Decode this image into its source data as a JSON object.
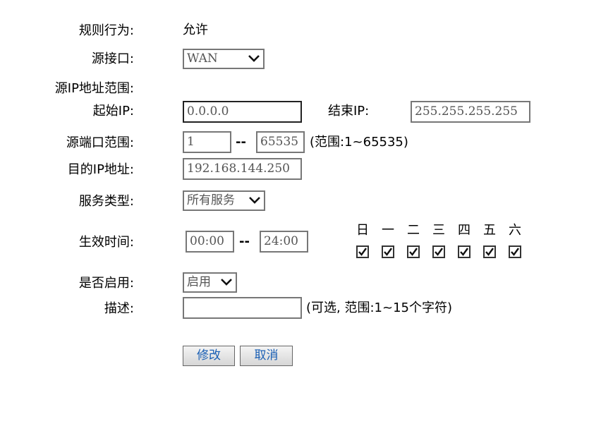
{
  "form": {
    "rule_action": {
      "label": "规则行为:",
      "value": "允许"
    },
    "src_interface": {
      "label": "源接口:",
      "value": "WAN"
    },
    "src_ip_range": {
      "label": "源IP地址范围:"
    },
    "start_ip": {
      "label": "起始IP:",
      "value": "0.0.0.0"
    },
    "end_ip": {
      "label": "结束IP:",
      "value": "255.255.255.255"
    },
    "src_port_range": {
      "label": "源端口范围:",
      "from": "1",
      "to": "65535",
      "separator": "--",
      "hint": "(范围:1~65535)"
    },
    "dest_ip": {
      "label": "目的IP地址:",
      "value": "192.168.144.250"
    },
    "service_type": {
      "label": "服务类型:",
      "value": "所有服务"
    },
    "effective_time": {
      "label": "生效时间:",
      "start": "00:00",
      "end": "24:00",
      "separator": "--",
      "days": [
        {
          "name": "日",
          "checked": true
        },
        {
          "name": "一",
          "checked": true
        },
        {
          "name": "二",
          "checked": true
        },
        {
          "name": "三",
          "checked": true
        },
        {
          "name": "四",
          "checked": true
        },
        {
          "name": "五",
          "checked": true
        },
        {
          "name": "六",
          "checked": true
        }
      ]
    },
    "enabled": {
      "label": "是否启用:",
      "value": "启用"
    },
    "description": {
      "label": "描述:",
      "value": "",
      "hint": "(可选, 范围:1~15个字符)"
    }
  },
  "buttons": {
    "modify": "修改",
    "cancel": "取消"
  }
}
